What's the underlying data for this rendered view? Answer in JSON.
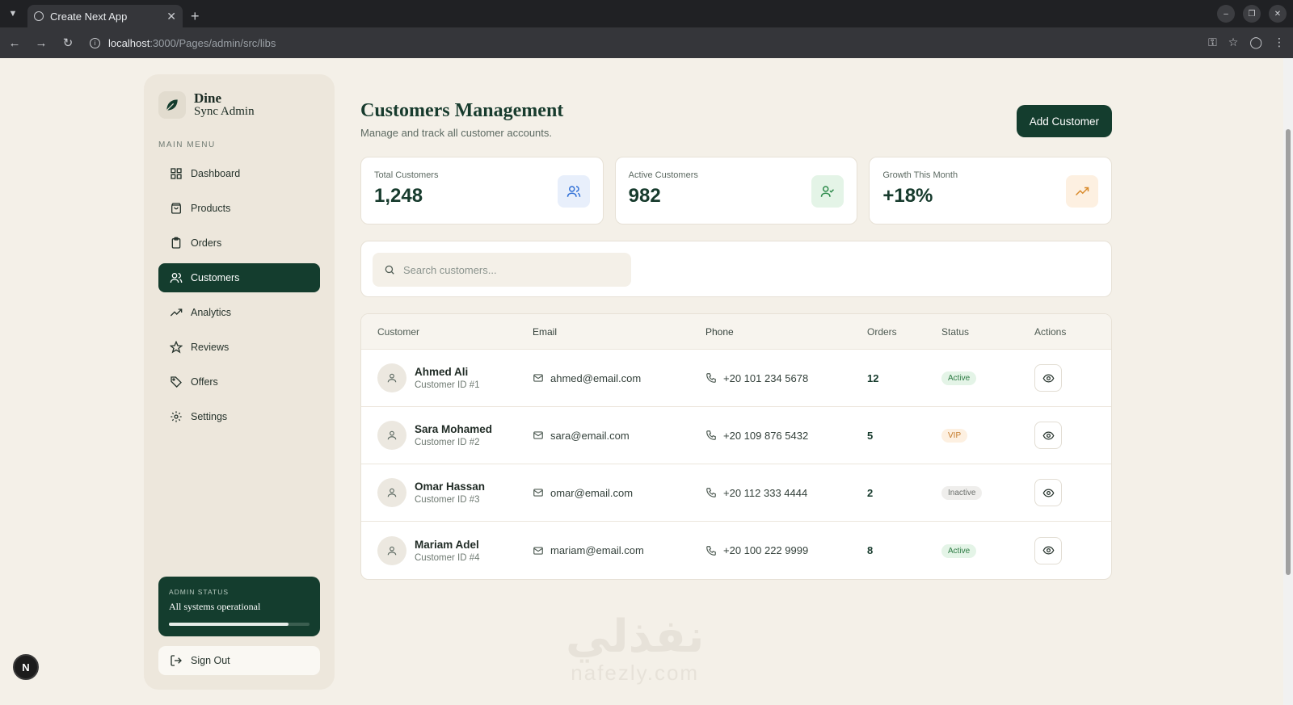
{
  "browser": {
    "tab_title": "Create Next App",
    "url_host": "localhost",
    "url_path": ":3000/Pages/admin/src/libs"
  },
  "sidebar": {
    "brand_line1": "Dine",
    "brand_line2": "Sync Admin",
    "menu_label": "MAIN MENU",
    "items": [
      {
        "label": "Dashboard",
        "icon": "grid-icon"
      },
      {
        "label": "Products",
        "icon": "bag-icon"
      },
      {
        "label": "Orders",
        "icon": "clipboard-icon"
      },
      {
        "label": "Customers",
        "icon": "users-icon",
        "active": true
      },
      {
        "label": "Analytics",
        "icon": "trending-up-icon"
      },
      {
        "label": "Reviews",
        "icon": "star-icon"
      },
      {
        "label": "Offers",
        "icon": "tag-icon"
      },
      {
        "label": "Settings",
        "icon": "gear-icon"
      }
    ],
    "status_label": "ADMIN STATUS",
    "status_text": "All systems operational",
    "status_progress": 0.85,
    "signout_label": "Sign Out"
  },
  "header": {
    "title": "Customers Management",
    "subtitle": "Manage and track all customer accounts.",
    "add_button": "Add Customer"
  },
  "stats": [
    {
      "label": "Total Customers",
      "value": "1,248",
      "icon": "users-icon",
      "color": "#2f6fd6",
      "bg": "#e8effb"
    },
    {
      "label": "Active Customers",
      "value": "982",
      "icon": "user-check-icon",
      "color": "#2c8a4a",
      "bg": "#e4f4e7"
    },
    {
      "label": "Growth This Month",
      "value": "+18%",
      "icon": "trending-up-icon",
      "color": "#d98a2b",
      "bg": "#fdf0e1"
    }
  ],
  "search": {
    "placeholder": "Search customers..."
  },
  "table": {
    "headers": [
      "Customer",
      "Email",
      "Phone",
      "Orders",
      "Status",
      "Actions"
    ],
    "rows": [
      {
        "name": "Ahmed Ali",
        "id": "Customer ID #1",
        "email": "ahmed@email.com",
        "phone": "+20 101 234 5678",
        "orders": "12",
        "status": "Active",
        "status_class": "active"
      },
      {
        "name": "Sara Mohamed",
        "id": "Customer ID #2",
        "email": "sara@email.com",
        "phone": "+20 109 876 5432",
        "orders": "5",
        "status": "VIP",
        "status_class": "vip"
      },
      {
        "name": "Omar Hassan",
        "id": "Customer ID #3",
        "email": "omar@email.com",
        "phone": "+20 112 333 4444",
        "orders": "2",
        "status": "Inactive",
        "status_class": "inactive"
      },
      {
        "name": "Mariam Adel",
        "id": "Customer ID #4",
        "email": "mariam@email.com",
        "phone": "+20 100 222 9999",
        "orders": "8",
        "status": "Active",
        "status_class": "active"
      }
    ]
  },
  "watermark": {
    "arabic": "نفذلي",
    "latin": "nafezly.com"
  },
  "next_badge": "N"
}
